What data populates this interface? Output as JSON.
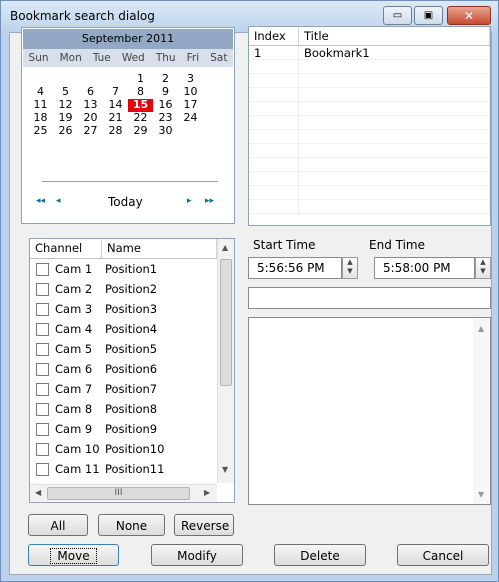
{
  "window": {
    "title": "Bookmark search dialog",
    "controls": {
      "minimize": "▭",
      "maximize": "▣",
      "close": "✕"
    }
  },
  "calendar": {
    "month_label": "September 2011",
    "day_names": [
      "Sun",
      "Mon",
      "Tue",
      "Wed",
      "Thu",
      "Fri",
      "Sat"
    ],
    "weeks": [
      [
        "",
        "",
        "",
        "",
        "1",
        "2",
        "3"
      ],
      [
        "4",
        "5",
        "6",
        "7",
        "8",
        "9",
        "10"
      ],
      [
        "11",
        "12",
        "13",
        "14",
        "15",
        "16",
        "17"
      ],
      [
        "18",
        "19",
        "20",
        "21",
        "22",
        "23",
        "24"
      ],
      [
        "25",
        "26",
        "27",
        "28",
        "29",
        "30",
        ""
      ]
    ],
    "selected_day": "15",
    "today_label": "Today",
    "nav": {
      "prev_year": "◂◂",
      "prev_month": "◂",
      "next_month": "▸",
      "next_year": "▸▸"
    }
  },
  "bookmarks": {
    "columns": [
      "Index",
      "Title"
    ],
    "rows": [
      {
        "index": "1",
        "title": "Bookmark1"
      }
    ]
  },
  "channels": {
    "columns": [
      "Channel",
      "Name"
    ],
    "rows": [
      {
        "channel": "Cam 1",
        "name": "Position1"
      },
      {
        "channel": "Cam 2",
        "name": "Position2"
      },
      {
        "channel": "Cam 3",
        "name": "Position3"
      },
      {
        "channel": "Cam 4",
        "name": "Position4"
      },
      {
        "channel": "Cam 5",
        "name": "Position5"
      },
      {
        "channel": "Cam 6",
        "name": "Position6"
      },
      {
        "channel": "Cam 7",
        "name": "Position7"
      },
      {
        "channel": "Cam 8",
        "name": "Position8"
      },
      {
        "channel": "Cam 9",
        "name": "Position9"
      },
      {
        "channel": "Cam 10",
        "name": "Position10"
      },
      {
        "channel": "Cam 11",
        "name": "Position11"
      }
    ],
    "hscroll_grip": "III"
  },
  "time": {
    "start_label": "Start Time",
    "end_label": "End Time",
    "start_value": "5:56:56 PM",
    "end_value": "5:58:00 PM"
  },
  "buttons": {
    "all": "All",
    "none": "None",
    "reverse": "Reverse",
    "move": "Move",
    "modify": "Modify",
    "delete": "Delete",
    "cancel": "Cancel"
  }
}
